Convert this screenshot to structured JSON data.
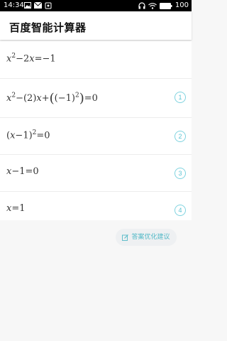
{
  "status_bar": {
    "time": "14:34",
    "battery": "100",
    "icons": [
      "image-icon",
      "mail-icon",
      "notification-icon",
      "headphones-icon",
      "wifi-icon",
      "battery-icon"
    ]
  },
  "header": {
    "title": "百度智能计算器"
  },
  "steps": [
    {
      "index": "",
      "expr_parts": [
        "x",
        "2",
        "−2",
        "x",
        "=−1"
      ]
    },
    {
      "index": "1"
    },
    {
      "index": "2"
    },
    {
      "index": "3"
    },
    {
      "index": "4"
    }
  ],
  "feedback": {
    "label": "答案优化建议",
    "icon": "edit-icon"
  },
  "colors": {
    "accent": "#53b9c7",
    "badge_border": "#7fd3df",
    "status_bar": "#000000"
  }
}
